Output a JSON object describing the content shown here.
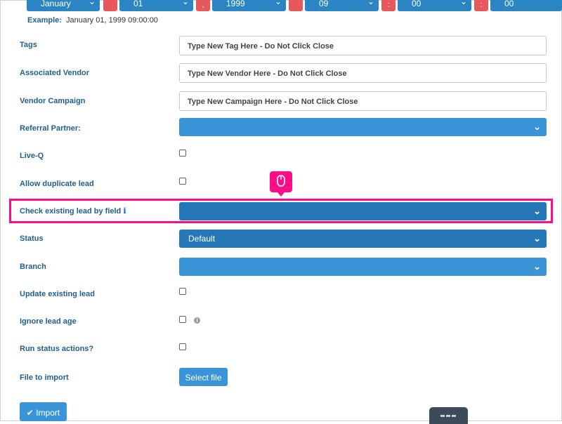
{
  "date": {
    "month": "January",
    "day": "01",
    "year": "1999",
    "hour": "09",
    "minute": "00",
    "second": "00",
    "sep_comma": ",",
    "sep_colon": ":",
    "example_label": "Example:",
    "example_value": "January 01, 1999 09:00:00"
  },
  "fields": {
    "tags": {
      "label": "Tags",
      "placeholder": "Type New Tag Here - Do Not Click Close"
    },
    "vendor": {
      "label": "Associated Vendor",
      "placeholder": "Type New Vendor Here - Do Not Click Close"
    },
    "campaign": {
      "label": "Vendor Campaign",
      "placeholder": "Type New Campaign Here - Do Not Click Close"
    },
    "referral": {
      "label": "Referral Partner:",
      "value": ""
    },
    "liveq": {
      "label": "Live-Q"
    },
    "duplicate": {
      "label": "Allow duplicate lead"
    },
    "check_existing": {
      "label": "Check existing lead by field",
      "info": "i",
      "value": ""
    },
    "status": {
      "label": "Status",
      "value": "Default"
    },
    "branch": {
      "label": "Branch",
      "value": ""
    },
    "update_existing": {
      "label": "Update existing lead"
    },
    "ignore_age": {
      "label": "Ignore lead age",
      "info": "i"
    },
    "run_status": {
      "label": "Run status actions?"
    },
    "file": {
      "label": "File to import",
      "button": "Select file"
    }
  },
  "import_button": {
    "label": "Import",
    "icon": "check-circle-icon"
  },
  "colors": {
    "accent": "#3a95d8",
    "accent_dark": "#2577b8",
    "highlight": "#ff0d89",
    "label": "#1f5f8f",
    "separator": "#e8575b"
  },
  "icons": {
    "chevron": "chevron-down-icon",
    "cursor": "mouse-icon"
  }
}
